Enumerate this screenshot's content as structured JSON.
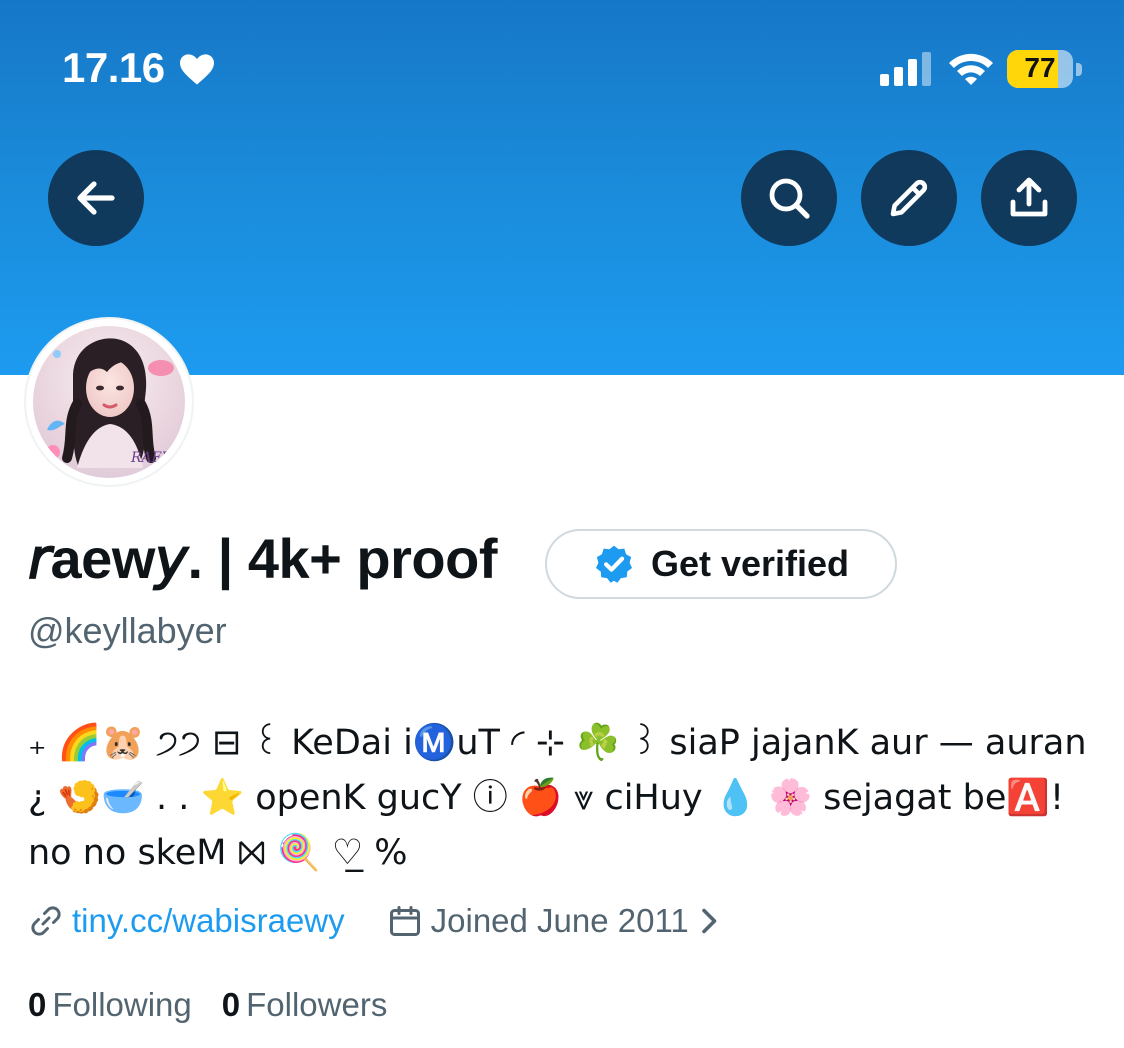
{
  "status_bar": {
    "time": "17.16",
    "battery_level": "77",
    "battery_fraction": 0.77
  },
  "nav": {
    "back_icon": "arrow-left-icon",
    "search_icon": "search-icon",
    "edit_icon": "pencil-icon",
    "share_icon": "share-icon"
  },
  "profile": {
    "avatar_watermark": "RAEWY",
    "display_name": "𝘳aew𝘺. | 4k+ proof",
    "get_verified_label": "Get verified",
    "handle": "@keyllabyer",
    "bio": "₊ 🌈🐹 ੭੭ ⊟ ꒰ KeDai iⓂ️uT ◜ ⊹ ☘️ ꒱ siaP jajanK aur — auran ¿ 🍤🥣 . . ⭐ openK gucY ⓘ 🍎 ⩔ ciHuy 💧 🌸 sejagat be🅰️! no no skeM ⨝ 🍭 ♡̲ %",
    "link": "tiny.cc/wabisraewy",
    "joined": "Joined June 2011",
    "following_count": "0",
    "following_label": "Following",
    "followers_count": "0",
    "followers_label": "Followers"
  },
  "colors": {
    "banner_top": "#1677c7",
    "banner_bottom": "#1d9bf0",
    "accent": "#1d9bf0",
    "muted": "#536471",
    "battery_yellow": "#ffd60a"
  }
}
